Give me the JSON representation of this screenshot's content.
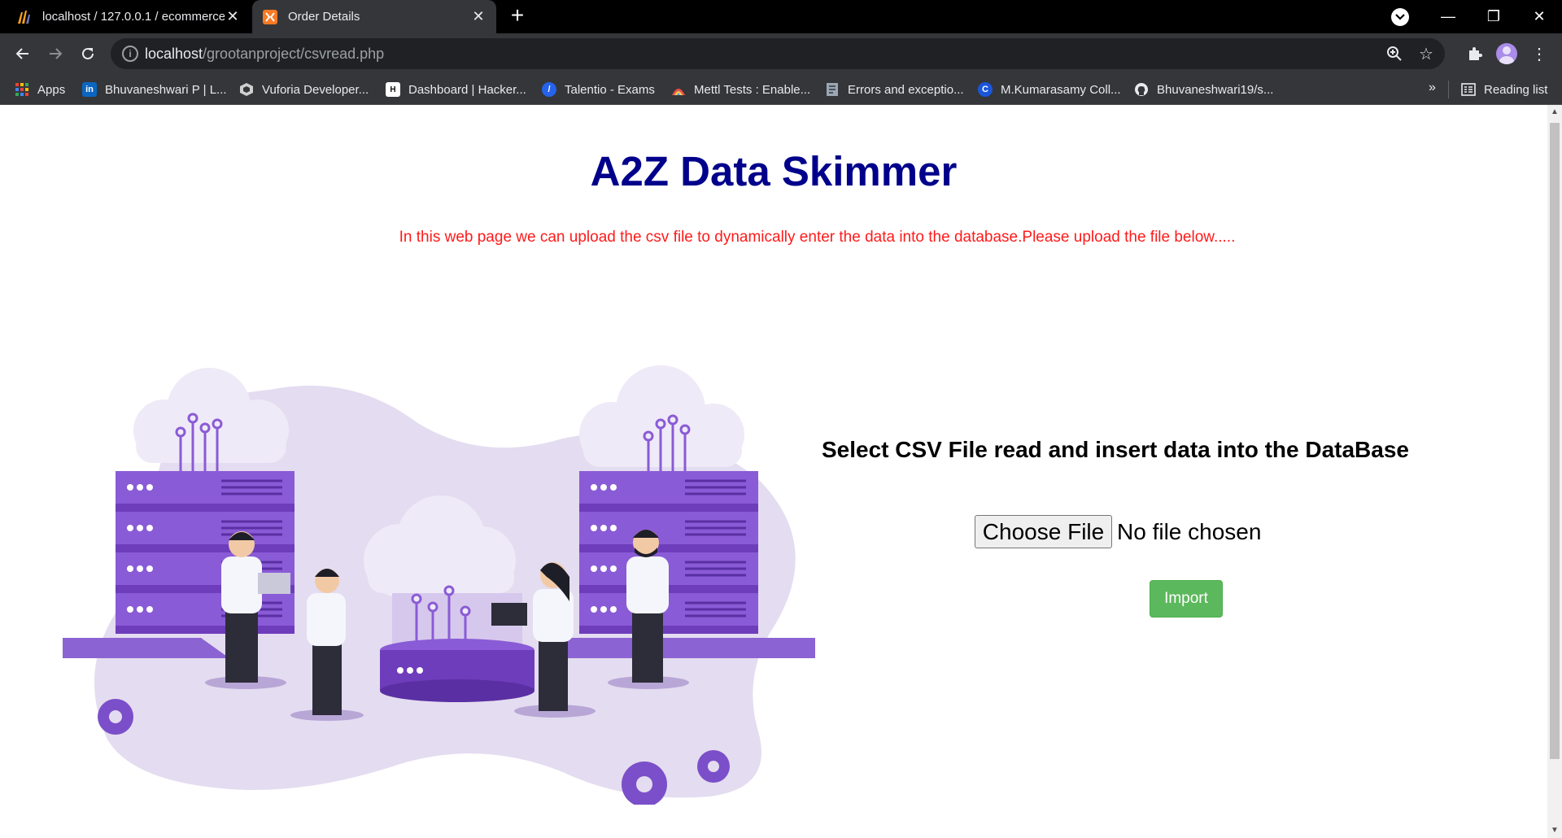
{
  "browser": {
    "tabs": [
      {
        "title": "localhost / 127.0.0.1 / ecommerce",
        "favicon": "phpmyadmin-icon",
        "active": false
      },
      {
        "title": "Order Details",
        "favicon": "xampp-icon",
        "active": true
      }
    ],
    "address": {
      "host": "localhost",
      "path": "/grootanproject/csvread.php"
    },
    "bookmarks": [
      {
        "label": "Apps",
        "icon": "apps-grid-icon"
      },
      {
        "label": "Bhuvaneshwari P | L...",
        "icon": "linkedin-icon"
      },
      {
        "label": "Vuforia Developer...",
        "icon": "vuforia-icon"
      },
      {
        "label": "Dashboard | Hacker...",
        "icon": "hackerrank-icon"
      },
      {
        "label": "Talentio - Exams",
        "icon": "talentio-icon"
      },
      {
        "label": "Mettl Tests : Enable...",
        "icon": "mettl-icon"
      },
      {
        "label": "Errors and exceptio...",
        "icon": "document-icon"
      },
      {
        "label": "M.Kumarasamy Coll...",
        "icon": "college-icon"
      },
      {
        "label": "Bhuvaneshwari19/s...",
        "icon": "github-icon"
      }
    ],
    "overflow_label": "»",
    "reading_list": "Reading list"
  },
  "page": {
    "title": "A2Z Data Skimmer",
    "description": "In this web page we can upload the csv file to dynamically enter the data into the database.Please upload the file below.....",
    "upload_heading": "Select CSV File read and insert data into the DataBase",
    "choose_file_label": "Choose File",
    "no_file_label": "No file chosen",
    "import_label": "Import"
  },
  "colors": {
    "title": "#00008b",
    "description": "#ff1a1a",
    "import_button": "#5cb85c",
    "illustration_purple": "#7b4fc9",
    "illustration_blob": "#e4dcf0"
  }
}
